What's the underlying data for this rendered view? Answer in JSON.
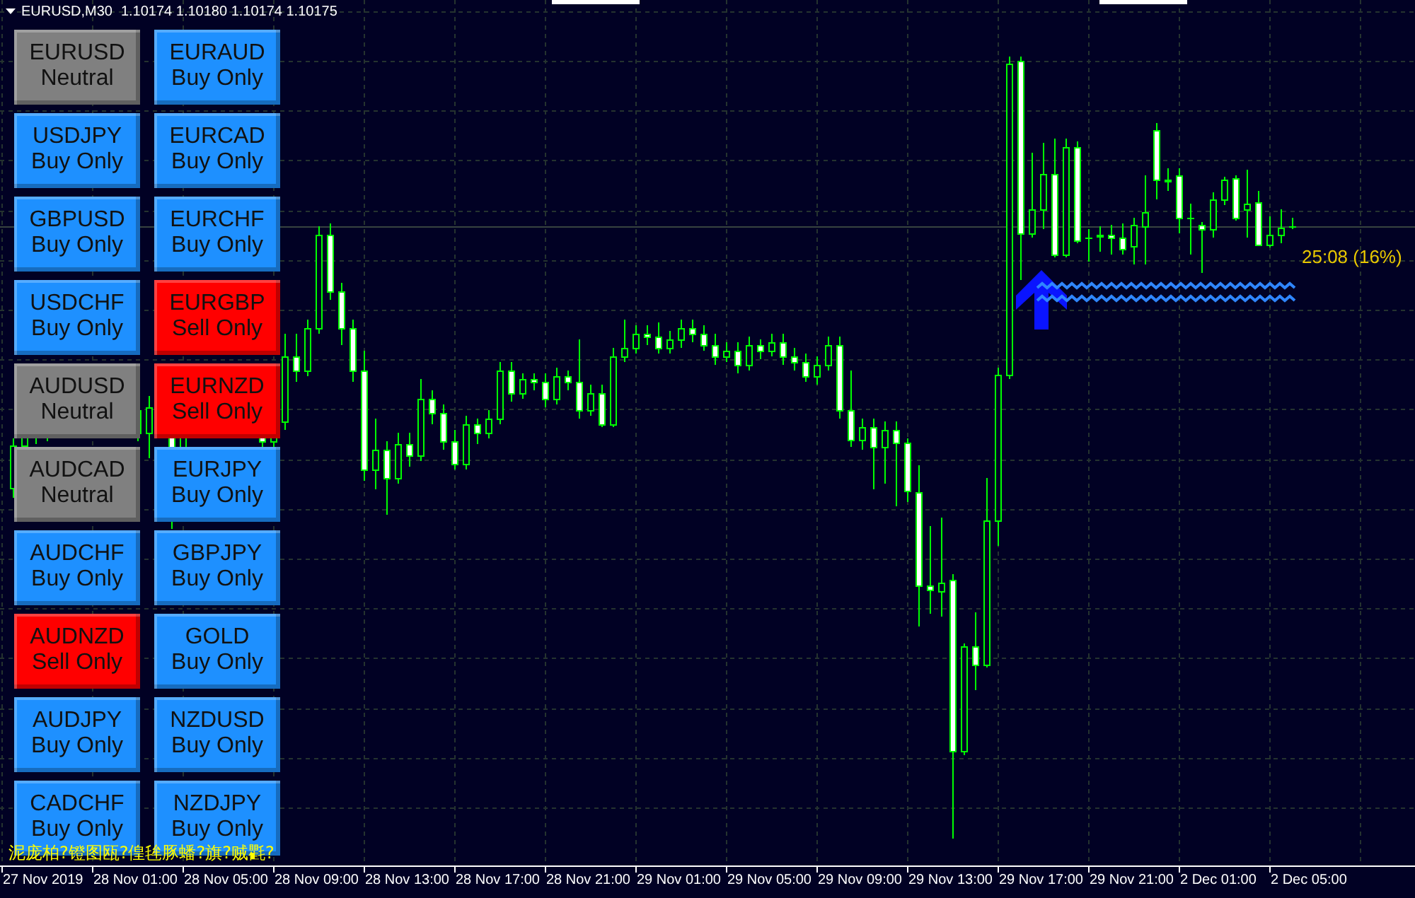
{
  "chart_header": {
    "symbol_period": "EURUSD,M30",
    "quotes": "1.10174 1.10180 1.10174 1.10175"
  },
  "symbol_buttons": [
    {
      "symbol": "EURUSD",
      "mode": "Neutral",
      "color": "#808080"
    },
    {
      "symbol": "EURAUD",
      "mode": "Buy Only",
      "color": "#1e90ff"
    },
    {
      "symbol": "USDJPY",
      "mode": "Buy Only",
      "color": "#1e90ff"
    },
    {
      "symbol": "EURCAD",
      "mode": "Buy Only",
      "color": "#1e90ff"
    },
    {
      "symbol": "GBPUSD",
      "mode": "Buy Only",
      "color": "#1e90ff"
    },
    {
      "symbol": "EURCHF",
      "mode": "Buy Only",
      "color": "#1e90ff"
    },
    {
      "symbol": "USDCHF",
      "mode": "Buy Only",
      "color": "#1e90ff"
    },
    {
      "symbol": "EURGBP",
      "mode": "Sell Only",
      "color": "#ff0000"
    },
    {
      "symbol": "AUDUSD",
      "mode": "Neutral",
      "color": "#808080"
    },
    {
      "symbol": "EURNZD",
      "mode": "Sell Only",
      "color": "#ff0000"
    },
    {
      "symbol": "AUDCAD",
      "mode": "Neutral",
      "color": "#808080"
    },
    {
      "symbol": "EURJPY",
      "mode": "Buy Only",
      "color": "#1e90ff"
    },
    {
      "symbol": "AUDCHF",
      "mode": "Buy Only",
      "color": "#1e90ff"
    },
    {
      "symbol": "GBPJPY",
      "mode": "Buy Only",
      "color": "#1e90ff"
    },
    {
      "symbol": "AUDNZD",
      "mode": "Sell Only",
      "color": "#ff0000"
    },
    {
      "symbol": "GOLD",
      "mode": "Buy Only",
      "color": "#1e90ff"
    },
    {
      "symbol": "AUDJPY",
      "mode": "Buy Only",
      "color": "#1e90ff"
    },
    {
      "symbol": "NZDUSD",
      "mode": "Buy Only",
      "color": "#1e90ff"
    },
    {
      "symbol": "CADCHF",
      "mode": "Buy Only",
      "color": "#1e90ff"
    },
    {
      "symbol": "NZDJPY",
      "mode": "Buy Only",
      "color": "#1e90ff"
    }
  ],
  "bar_timer": "25:08 (16%)",
  "status_text": "泥庞柏?镫图瓯?偟毪豚蟠?旗?贼氍?",
  "time_axis": [
    "27 Nov 2019",
    "28 Nov 01:00",
    "28 Nov 05:00",
    "28 Nov 09:00",
    "28 Nov 13:00",
    "28 Nov 17:00",
    "28 Nov 21:00",
    "29 Nov 01:00",
    "29 Nov 05:00",
    "29 Nov 09:00",
    "29 Nov 13:00",
    "29 Nov 17:00",
    "29 Nov 21:00",
    "2 Dec 01:00",
    "2 Dec 05:00"
  ]
}
